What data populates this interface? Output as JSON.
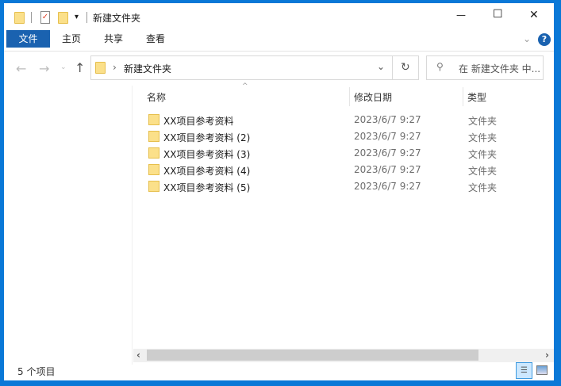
{
  "window": {
    "title": "新建文件夹",
    "minimize": "—",
    "maximize": "☐",
    "close": "✕"
  },
  "ribbon": {
    "tabs": [
      "文件",
      "主页",
      "共享",
      "查看"
    ],
    "collapse": "⌄",
    "help": "?"
  },
  "address": {
    "path": "新建文件夹",
    "search_placeholder": "在 新建文件夹 中..."
  },
  "columns": {
    "name": "名称",
    "date": "修改日期",
    "type": "类型"
  },
  "files": [
    {
      "name": "XX项目参考资料",
      "date": "2023/6/7 9:27",
      "type": "文件夹"
    },
    {
      "name": "XX项目参考资料 (2)",
      "date": "2023/6/7 9:27",
      "type": "文件夹"
    },
    {
      "name": "XX项目参考资料 (3)",
      "date": "2023/6/7 9:27",
      "type": "文件夹"
    },
    {
      "name": "XX项目参考资料 (4)",
      "date": "2023/6/7 9:27",
      "type": "文件夹"
    },
    {
      "name": "XX项目参考资料 (5)",
      "date": "2023/6/7 9:27",
      "type": "文件夹"
    }
  ],
  "status": {
    "count": "5 个项目"
  },
  "colors": {
    "accent": "#0063b1",
    "folder": "#fbe08a"
  }
}
